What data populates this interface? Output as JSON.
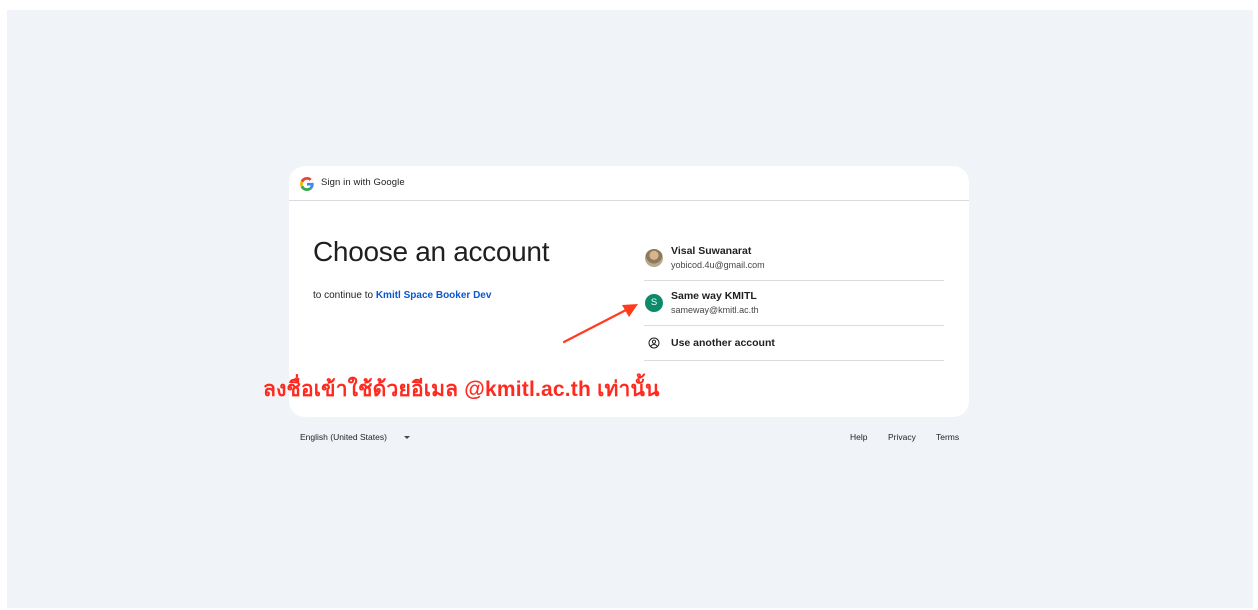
{
  "header": {
    "title": "Sign in with Google",
    "logo_icon": "google-g-logo"
  },
  "main": {
    "heading": "Choose an account",
    "subtext_prefix": "to continue to ",
    "app_name": "Kmitl Space Booker Dev"
  },
  "accounts": [
    {
      "name": "Visal Suwanarat",
      "email": "yobicod.4u@gmail.com",
      "avatar": "photo"
    },
    {
      "name": "Same way KMITL",
      "email": "sameway@kmitl.ac.th",
      "avatar_letter": "S",
      "avatar_color": "#0d8a6a"
    }
  ],
  "another_account": {
    "label": "Use another account",
    "icon": "person-circle-icon"
  },
  "annotation": {
    "text": "ลงชื่อเข้าใช้ด้วยอีเมล @kmitl.ac.th เท่านั้น",
    "color": "#ff2a1f"
  },
  "footer": {
    "language": "English (United States)",
    "help": "Help",
    "privacy": "Privacy",
    "terms": "Terms"
  },
  "colors": {
    "background": "#f0f4f9",
    "link": "#0b57d0",
    "divider": "#dadce0"
  }
}
